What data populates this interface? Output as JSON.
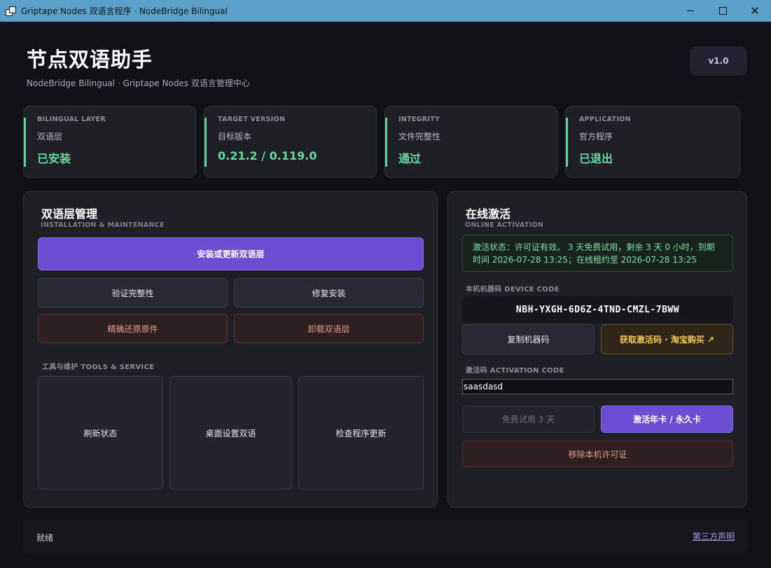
{
  "window": {
    "title": "Griptape Nodes 双语言程序 · NodeBridge Bilingual"
  },
  "header": {
    "title": "节点双语助手",
    "subtitle": "NodeBridge Bilingual · Griptape Nodes 双语言管理中心",
    "version": "v1.0"
  },
  "stats": [
    {
      "en": "BILINGUAL LAYER",
      "cn": "双语层",
      "value": "已安装"
    },
    {
      "en": "TARGET VERSION",
      "cn": "目标版本",
      "value": "0.21.2 / 0.119.0"
    },
    {
      "en": "INTEGRITY",
      "cn": "文件完整性",
      "value": "通过"
    },
    {
      "en": "APPLICATION",
      "cn": "官方程序",
      "value": "已退出"
    }
  ],
  "manage": {
    "title": "双语层管理",
    "subtitle": "INSTALLATION & MAINTENANCE",
    "install_label": "安装或更新双语层",
    "verify_label": "验证完整性",
    "repair_label": "修复安装",
    "restore_label": "精确还原原件",
    "uninstall_label": "卸载双语层",
    "tools_label": "工具与维护  TOOLS & SERVICE",
    "tools": [
      "刷新状态",
      "桌面设置双语",
      "检查程序更新"
    ]
  },
  "activation": {
    "title": "在线激活",
    "subtitle": "ONLINE ACTIVATION",
    "status_line1": "激活状态：许可证有效。  3 天免费试用，剩余 3 天 0 小时，到期",
    "status_line2": "时间 2026-07-28 13:25；在线租约至 2026-07-28 13:25",
    "device_label": "本机机器码  DEVICE CODE",
    "device_code": "NBH-YXGH-6D6Z-4TND-CMZL-7BWW",
    "copy_label": "复制机器码",
    "buy_label": "获取激活码 · 淘宝购买  ↗",
    "code_label": "激活码  ACTIVATION CODE",
    "code_value": "saasdasd",
    "trial_label": "免费试用 3 天",
    "activate_label": "激活年卡 / 永久卡",
    "remove_label": "移除本机许可证"
  },
  "statusbar": {
    "status": "就绪",
    "link": "第三方声明"
  },
  "colors": {
    "accent": "#6c4fd0",
    "success": "#66d9a0",
    "danger": "#e89a8e",
    "gold": "#f5c65c"
  }
}
